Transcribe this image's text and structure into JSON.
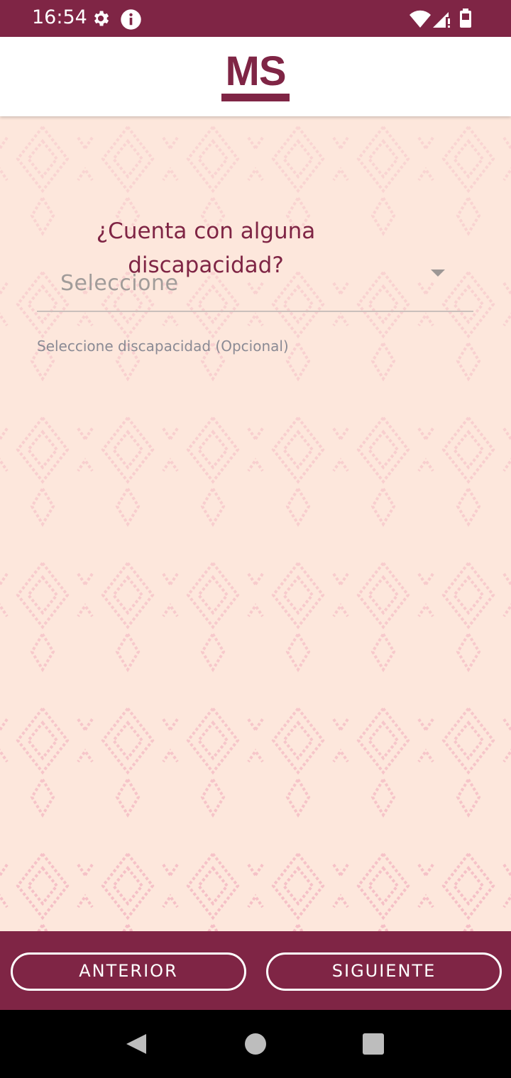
{
  "status_bar": {
    "time": "16:54",
    "left_icons": [
      "gear-icon",
      "info-icon"
    ],
    "right_icons": [
      "wifi-icon",
      "signal-icon",
      "battery-icon"
    ]
  },
  "header": {
    "logo_text": "MS"
  },
  "form": {
    "question": "¿Cuenta con alguna discapacidad?",
    "dropdown_value": "Seleccione",
    "helper_text": "Seleccione discapacidad (Opcional)"
  },
  "buttons": {
    "previous_label": "ANTERIOR",
    "next_label": "SIGUIENTE"
  },
  "colors": {
    "brand": "#7f2545",
    "background": "#fde7dc",
    "pattern": "#f5bfc6"
  },
  "system_nav": {
    "icons": [
      "back-icon",
      "home-icon",
      "recents-icon"
    ]
  }
}
